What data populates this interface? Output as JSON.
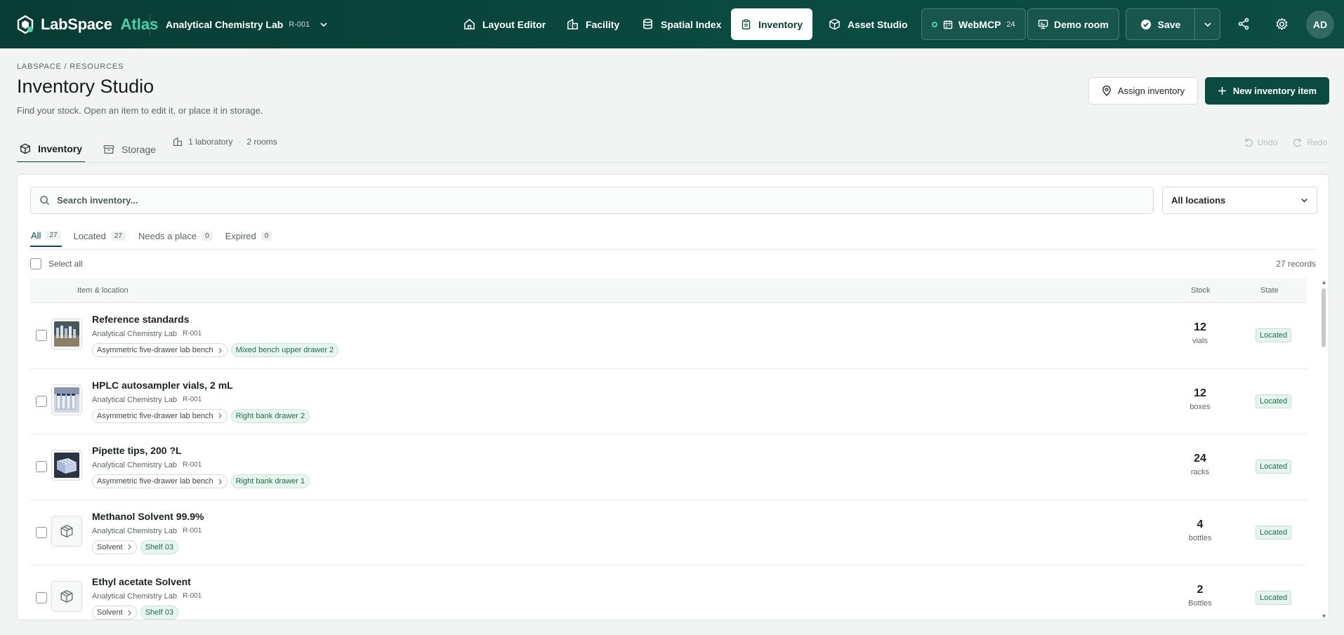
{
  "header": {
    "brand_name": "LabSpace",
    "brand_suffix": "Atlas",
    "lab_name": "Analytical Chemistry Lab",
    "lab_code": "R-001",
    "nav": [
      {
        "label": "Layout Editor",
        "icon": "home-icon"
      },
      {
        "label": "Facility",
        "icon": "building-icon"
      },
      {
        "label": "Spatial Index",
        "icon": "database-icon"
      },
      {
        "label": "Inventory",
        "icon": "clipboard-icon",
        "active": true
      },
      {
        "label": "Asset Studio",
        "icon": "cube-icon"
      }
    ],
    "webmcp_label": "WebMCP",
    "webmcp_count": "24",
    "demo_label": "Demo room",
    "save_label": "Save",
    "avatar": "AD"
  },
  "page": {
    "breadcrumb": "LABSPACE / RESOURCES",
    "title": "Inventory Studio",
    "subtitle": "Find your stock. Open an item to edit it, or place it in storage.",
    "assign_label": "Assign inventory",
    "new_label": "New inventory item",
    "tabs": {
      "inventory": "Inventory",
      "storage": "Storage"
    },
    "scope_labs": "1 laboratory",
    "scope_rooms": "2 rooms",
    "undo": "Undo",
    "redo": "Redo"
  },
  "list": {
    "search_placeholder": "Search inventory...",
    "location_filter": "All locations",
    "filters": [
      {
        "label": "All",
        "count": "27",
        "active": true
      },
      {
        "label": "Located",
        "count": "27"
      },
      {
        "label": "Needs a place",
        "count": "0"
      },
      {
        "label": "Expired",
        "count": "0"
      }
    ],
    "select_all": "Select all",
    "records": "27 records",
    "columns": {
      "item": "Item & location",
      "stock": "Stock",
      "state": "State"
    },
    "rows": [
      {
        "name": "Reference standards",
        "lab": "Analytical Chemistry Lab",
        "code": "R-001",
        "parent": "Asymmetric five-drawer lab bench",
        "place": "Mixed bench upper drawer 2",
        "stock": "12",
        "unit": "vials",
        "state": "Located",
        "thumb": "photo"
      },
      {
        "name": "HPLC autosampler vials, 2 mL",
        "lab": "Analytical Chemistry Lab",
        "code": "R-001",
        "parent": "Asymmetric five-drawer lab bench",
        "place": "Right bank drawer 2",
        "stock": "12",
        "unit": "boxes",
        "state": "Located",
        "thumb": "photo"
      },
      {
        "name": "Pipette tips, 200 ?L",
        "lab": "Analytical Chemistry Lab",
        "code": "R-001",
        "parent": "Asymmetric five-drawer lab bench",
        "place": "Right bank drawer 1",
        "stock": "24",
        "unit": "racks",
        "state": "Located",
        "thumb": "photo"
      },
      {
        "name": "Methanol Solvent 99.9%",
        "lab": "Analytical Chemistry Lab",
        "code": "R-001",
        "parent": "Solvent",
        "place": "Shelf 03",
        "stock": "4",
        "unit": "bottles",
        "state": "Located",
        "thumb": "cube-icon"
      },
      {
        "name": "Ethyl acetate Solvent",
        "lab": "Analytical Chemistry Lab",
        "code": "R-001",
        "parent": "Solvent",
        "place": "Shelf 03",
        "stock": "2",
        "unit": "Bottles",
        "state": "Located",
        "thumb": "cube-icon"
      }
    ]
  },
  "colors": {
    "brand": "#0b4a40",
    "accent": "#4fd1a5",
    "located": "#1e6e51"
  }
}
